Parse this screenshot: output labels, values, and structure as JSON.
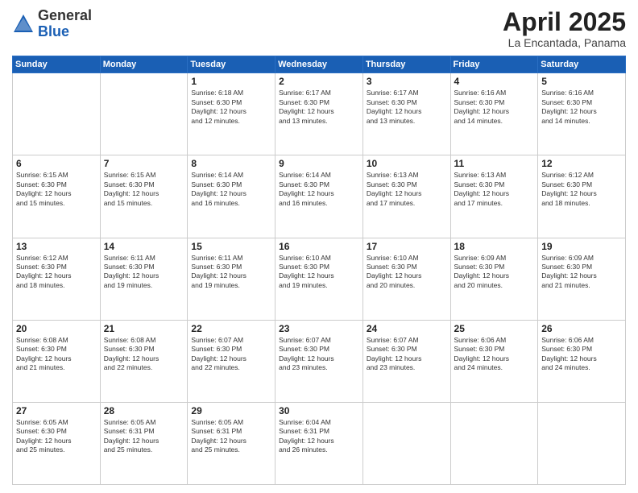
{
  "logo": {
    "general": "General",
    "blue": "Blue"
  },
  "title": "April 2025",
  "location": "La Encantada, Panama",
  "weekdays": [
    "Sunday",
    "Monday",
    "Tuesday",
    "Wednesday",
    "Thursday",
    "Friday",
    "Saturday"
  ],
  "weeks": [
    [
      {
        "day": "",
        "info": ""
      },
      {
        "day": "",
        "info": ""
      },
      {
        "day": "1",
        "info": "Sunrise: 6:18 AM\nSunset: 6:30 PM\nDaylight: 12 hours\nand 12 minutes."
      },
      {
        "day": "2",
        "info": "Sunrise: 6:17 AM\nSunset: 6:30 PM\nDaylight: 12 hours\nand 13 minutes."
      },
      {
        "day": "3",
        "info": "Sunrise: 6:17 AM\nSunset: 6:30 PM\nDaylight: 12 hours\nand 13 minutes."
      },
      {
        "day": "4",
        "info": "Sunrise: 6:16 AM\nSunset: 6:30 PM\nDaylight: 12 hours\nand 14 minutes."
      },
      {
        "day": "5",
        "info": "Sunrise: 6:16 AM\nSunset: 6:30 PM\nDaylight: 12 hours\nand 14 minutes."
      }
    ],
    [
      {
        "day": "6",
        "info": "Sunrise: 6:15 AM\nSunset: 6:30 PM\nDaylight: 12 hours\nand 15 minutes."
      },
      {
        "day": "7",
        "info": "Sunrise: 6:15 AM\nSunset: 6:30 PM\nDaylight: 12 hours\nand 15 minutes."
      },
      {
        "day": "8",
        "info": "Sunrise: 6:14 AM\nSunset: 6:30 PM\nDaylight: 12 hours\nand 16 minutes."
      },
      {
        "day": "9",
        "info": "Sunrise: 6:14 AM\nSunset: 6:30 PM\nDaylight: 12 hours\nand 16 minutes."
      },
      {
        "day": "10",
        "info": "Sunrise: 6:13 AM\nSunset: 6:30 PM\nDaylight: 12 hours\nand 17 minutes."
      },
      {
        "day": "11",
        "info": "Sunrise: 6:13 AM\nSunset: 6:30 PM\nDaylight: 12 hours\nand 17 minutes."
      },
      {
        "day": "12",
        "info": "Sunrise: 6:12 AM\nSunset: 6:30 PM\nDaylight: 12 hours\nand 18 minutes."
      }
    ],
    [
      {
        "day": "13",
        "info": "Sunrise: 6:12 AM\nSunset: 6:30 PM\nDaylight: 12 hours\nand 18 minutes."
      },
      {
        "day": "14",
        "info": "Sunrise: 6:11 AM\nSunset: 6:30 PM\nDaylight: 12 hours\nand 19 minutes."
      },
      {
        "day": "15",
        "info": "Sunrise: 6:11 AM\nSunset: 6:30 PM\nDaylight: 12 hours\nand 19 minutes."
      },
      {
        "day": "16",
        "info": "Sunrise: 6:10 AM\nSunset: 6:30 PM\nDaylight: 12 hours\nand 19 minutes."
      },
      {
        "day": "17",
        "info": "Sunrise: 6:10 AM\nSunset: 6:30 PM\nDaylight: 12 hours\nand 20 minutes."
      },
      {
        "day": "18",
        "info": "Sunrise: 6:09 AM\nSunset: 6:30 PM\nDaylight: 12 hours\nand 20 minutes."
      },
      {
        "day": "19",
        "info": "Sunrise: 6:09 AM\nSunset: 6:30 PM\nDaylight: 12 hours\nand 21 minutes."
      }
    ],
    [
      {
        "day": "20",
        "info": "Sunrise: 6:08 AM\nSunset: 6:30 PM\nDaylight: 12 hours\nand 21 minutes."
      },
      {
        "day": "21",
        "info": "Sunrise: 6:08 AM\nSunset: 6:30 PM\nDaylight: 12 hours\nand 22 minutes."
      },
      {
        "day": "22",
        "info": "Sunrise: 6:07 AM\nSunset: 6:30 PM\nDaylight: 12 hours\nand 22 minutes."
      },
      {
        "day": "23",
        "info": "Sunrise: 6:07 AM\nSunset: 6:30 PM\nDaylight: 12 hours\nand 23 minutes."
      },
      {
        "day": "24",
        "info": "Sunrise: 6:07 AM\nSunset: 6:30 PM\nDaylight: 12 hours\nand 23 minutes."
      },
      {
        "day": "25",
        "info": "Sunrise: 6:06 AM\nSunset: 6:30 PM\nDaylight: 12 hours\nand 24 minutes."
      },
      {
        "day": "26",
        "info": "Sunrise: 6:06 AM\nSunset: 6:30 PM\nDaylight: 12 hours\nand 24 minutes."
      }
    ],
    [
      {
        "day": "27",
        "info": "Sunrise: 6:05 AM\nSunset: 6:30 PM\nDaylight: 12 hours\nand 25 minutes."
      },
      {
        "day": "28",
        "info": "Sunrise: 6:05 AM\nSunset: 6:31 PM\nDaylight: 12 hours\nand 25 minutes."
      },
      {
        "day": "29",
        "info": "Sunrise: 6:05 AM\nSunset: 6:31 PM\nDaylight: 12 hours\nand 25 minutes."
      },
      {
        "day": "30",
        "info": "Sunrise: 6:04 AM\nSunset: 6:31 PM\nDaylight: 12 hours\nand 26 minutes."
      },
      {
        "day": "",
        "info": ""
      },
      {
        "day": "",
        "info": ""
      },
      {
        "day": "",
        "info": ""
      }
    ]
  ]
}
